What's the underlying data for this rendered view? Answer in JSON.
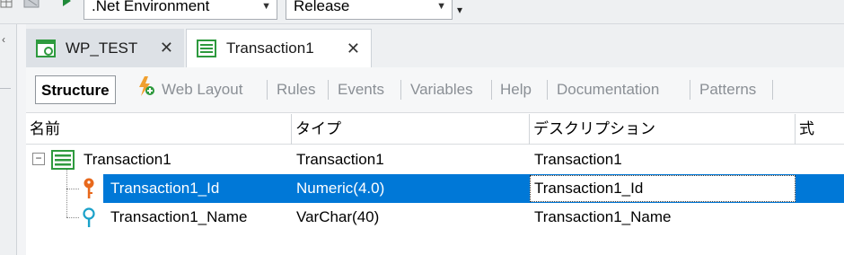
{
  "toolbar": {
    "environment_value": ".Net Environment",
    "configuration_value": "Release",
    "overflow_label": "▾"
  },
  "tabs": [
    {
      "label": "WP_TEST",
      "close": "✕"
    },
    {
      "label": "Transaction1",
      "close": "✕"
    }
  ],
  "editor_tabs": [
    "Structure",
    "Web Layout",
    "Rules",
    "Events",
    "Variables",
    "Help",
    "Documentation",
    "Patterns"
  ],
  "grid": {
    "columns": [
      "名前",
      "タイプ",
      "デスクリプション",
      "式"
    ],
    "rows": [
      {
        "name": "Transaction1",
        "type": "Transaction1",
        "description": "Transaction1"
      },
      {
        "name": "Transaction1_Id",
        "type": "Numeric(4.0)",
        "description": "Transaction1_Id"
      },
      {
        "name": "Transaction1_Name",
        "type": "VarChar(40)",
        "description": "Transaction1_Name"
      }
    ],
    "expander": "−"
  },
  "icons": {
    "transaction": "table-icon",
    "key": "key-icon",
    "attribute": "search-attribute-icon",
    "web_layout": "lightning-plus-icon"
  },
  "colors": {
    "selection": "#0078d7",
    "key": "#e8691d",
    "attribute": "#1aa1c9",
    "transaction_icon": "#2e9a3e"
  }
}
